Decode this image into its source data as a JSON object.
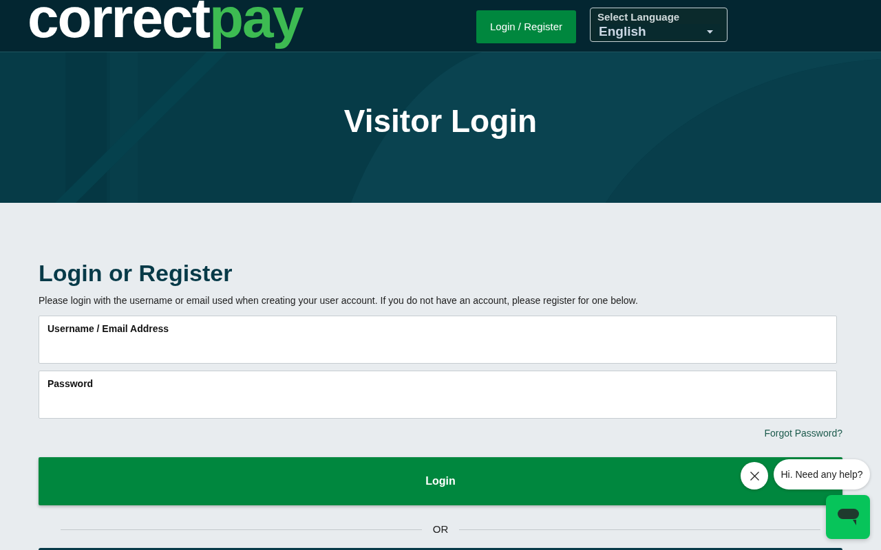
{
  "header": {
    "logo": {
      "main": "correct",
      "accent": "pay"
    },
    "login_button": "Login / Register",
    "language": {
      "label": "Select Language",
      "value": "English"
    }
  },
  "hero": {
    "title": "Visitor Login"
  },
  "form": {
    "heading": "Login or Register",
    "intro": "Please login with the username or email used when creating your user account. If you do not have an account, please register for one below.",
    "fields": [
      {
        "label": "Username / Email Address"
      },
      {
        "label": "Password"
      }
    ],
    "forgot_link": "Forgot Password?",
    "submit_button": "Login",
    "divider": "OR"
  },
  "chat": {
    "greeting": "Hi. Need any help?"
  }
}
